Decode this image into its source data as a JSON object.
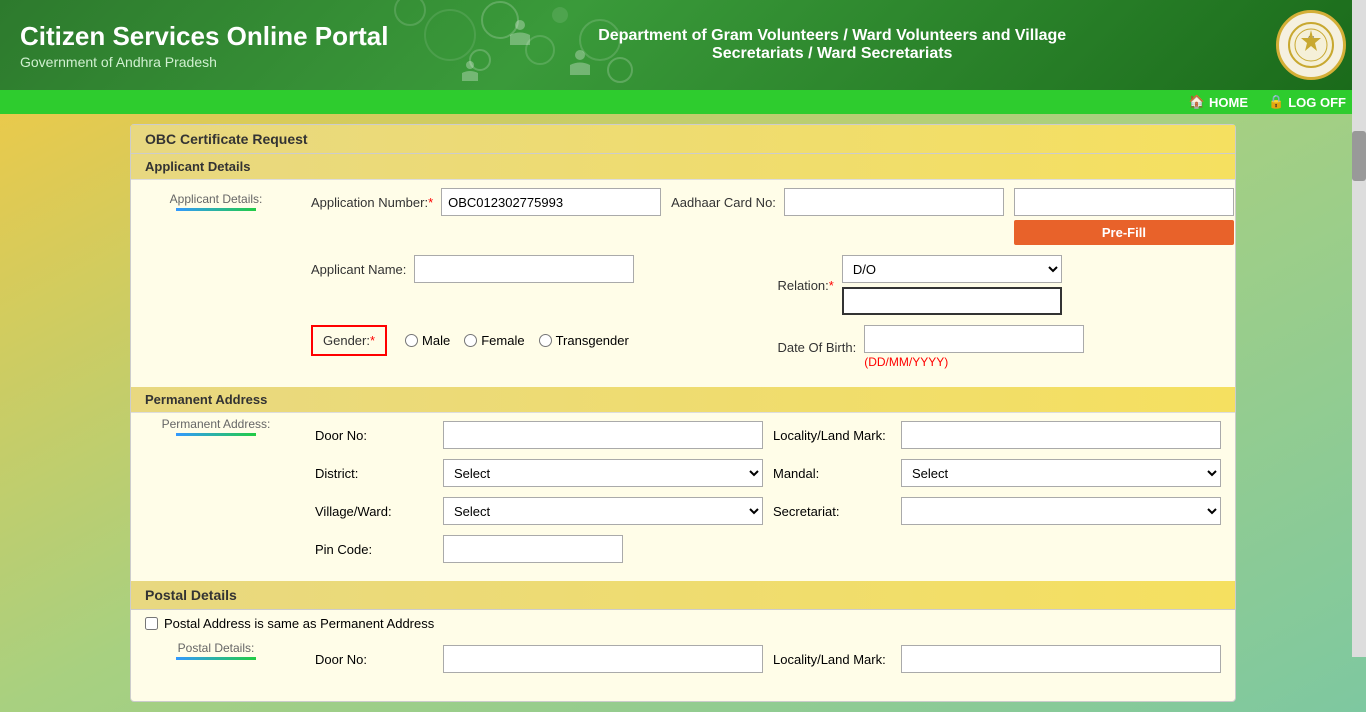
{
  "header": {
    "title": "Citizen Services Online Portal",
    "subtitle": "Government of Andhra Pradesh",
    "department": "Department of Gram Volunteers / Ward Volunteers and Village Secretariats / Ward Secretariats"
  },
  "navbar": {
    "home_label": "HOME",
    "logoff_label": "LOG OFF"
  },
  "form": {
    "page_title": "OBC Certificate Request",
    "applicant_section": "Applicant Details",
    "applicant_label": "Applicant Details:",
    "application_number_label": "Application Number:",
    "application_number_value": "OBC012302775993",
    "aadhaar_label": "Aadhaar Card No:",
    "prefill_label": "Pre-Fill",
    "applicant_name_label": "Applicant Name:",
    "relation_label": "Relation:",
    "relation_option": "D/O",
    "gender_label": "Gender:",
    "gender_male": "Male",
    "gender_female": "Female",
    "gender_transgender": "Transgender",
    "dob_label": "Date Of Birth:",
    "dob_hint": "(DD/MM/YYYY)",
    "perm_section": "Permanent Address",
    "perm_label": "Permanent Address:",
    "door_no_label": "Door No:",
    "locality_label": "Locality/Land Mark:",
    "district_label": "District:",
    "mandal_label": "Mandal:",
    "village_ward_label": "Village/Ward:",
    "secretariat_label": "Secretariat:",
    "pin_code_label": "Pin Code:",
    "select_placeholder": "Select",
    "postal_section": "Postal Details",
    "postal_checkbox_label": "Postal Address is same as Permanent Address",
    "postal_label": "Postal Details:"
  }
}
